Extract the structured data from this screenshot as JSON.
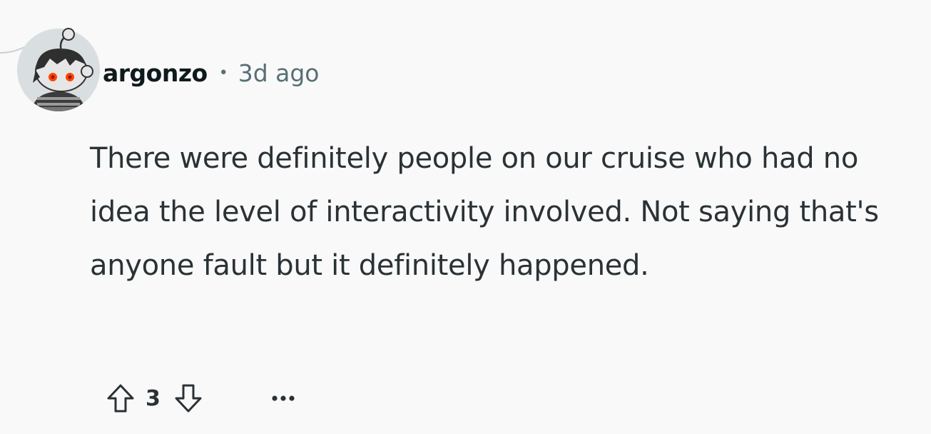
{
  "comment": {
    "username": "argonzo",
    "separator": "•",
    "time_ago": "3d ago",
    "body": "There were definitely people on our cruise who had no idea the level of interactivity involved. Not saying that's anyone fault but it definitely happened.",
    "score": "3",
    "avatar_icon": "snoo-avatar-icon",
    "upvote_icon": "upvote-arrow-icon",
    "downvote_icon": "downvote-arrow-icon",
    "more_icon": "more-options-icon"
  },
  "colors": {
    "background": "#f9f9f9",
    "text": "#2a3236",
    "meta": "#576f76",
    "avatar_eye": "#ff4500"
  }
}
